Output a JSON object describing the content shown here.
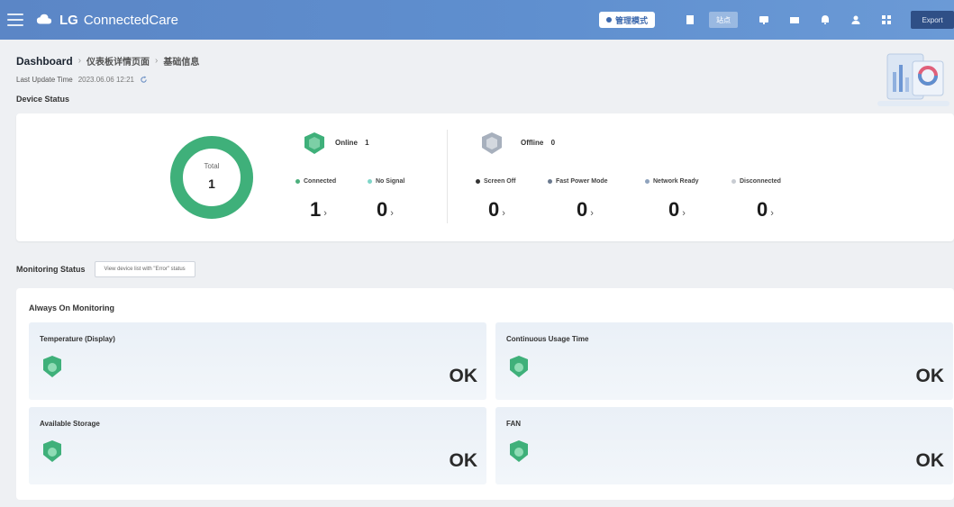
{
  "topbar": {
    "brand_lg": "LG",
    "brand_name": "ConnectedCare",
    "mode_label": "管理模式",
    "site_label": "站点",
    "export_label": "Export"
  },
  "header": {
    "title": "Dashboard",
    "breadcrumb": [
      "仪表板详情页面",
      "基础信息"
    ],
    "update_label": "Last Update Time",
    "update_time": "2023.06.06 12:21",
    "device_section": "Device Status"
  },
  "device_status": {
    "total_label": "Total",
    "total_value": "1",
    "online": {
      "title": "Online",
      "count": "1",
      "items": [
        {
          "label": "Connected",
          "value": "1",
          "color": "#4caf7d"
        },
        {
          "label": "No Signal",
          "value": "0",
          "color": "#7fd6c8"
        }
      ]
    },
    "offline": {
      "title": "Offline",
      "count": "0",
      "items": [
        {
          "label": "Screen Off",
          "value": "0",
          "color": "#333333"
        },
        {
          "label": "Fast Power Mode",
          "value": "0",
          "color": "#6b7a8f"
        },
        {
          "label": "Network Ready",
          "value": "0",
          "color": "#8fa3bd"
        },
        {
          "label": "Disconnected",
          "value": "0",
          "color": "#c8ccd2"
        }
      ]
    },
    "donut_color": "#3fb07a",
    "online_fraction": 1.0
  },
  "monitoring": {
    "title": "Monitoring Status",
    "filter_button": "View device list with \"Error\" status",
    "card_title": "Always On Monitoring",
    "tiles": [
      {
        "label": "Temperature (Display)",
        "status": "OK"
      },
      {
        "label": "Continuous Usage Time",
        "status": "OK"
      },
      {
        "label": "Available Storage",
        "status": "OK"
      },
      {
        "label": "FAN",
        "status": "OK"
      }
    ]
  },
  "colors": {
    "topbar": "#5f8fcf",
    "ok_green": "#3fb07a"
  }
}
